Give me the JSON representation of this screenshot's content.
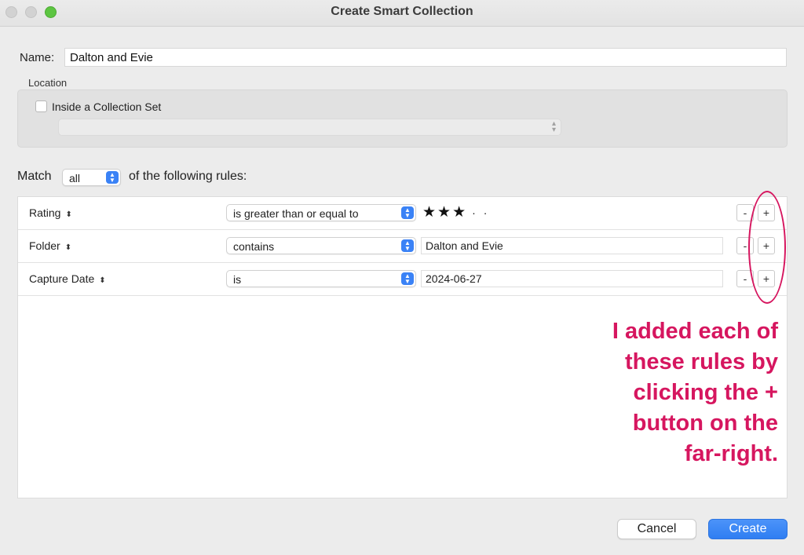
{
  "window": {
    "title": "Create Smart Collection"
  },
  "name": {
    "label": "Name:",
    "value": "Dalton and Evie"
  },
  "location": {
    "label": "Location",
    "checkbox_label": "Inside a Collection Set",
    "checked": false,
    "collection_set_value": ""
  },
  "match": {
    "prefix": "Match",
    "value": "all",
    "suffix": "of the following rules:"
  },
  "rules": [
    {
      "field": "Rating",
      "operator": "is greater than or equal to",
      "value": "★★★",
      "rating": 3,
      "rating_max": 5
    },
    {
      "field": "Folder",
      "operator": "contains",
      "value": "Dalton and Evie"
    },
    {
      "field": "Capture Date",
      "operator": "is",
      "value": "2024-06-27"
    }
  ],
  "rule_buttons": {
    "remove": "-",
    "add": "+"
  },
  "annotation": {
    "text_lines": [
      "I added each of",
      "these rules by",
      "clicking the +",
      "button on the",
      "far-right."
    ],
    "color": "#d6165f"
  },
  "buttons": {
    "cancel": "Cancel",
    "create": "Create"
  },
  "colors": {
    "accent": "#3a82f6",
    "annotation": "#d6165f"
  }
}
